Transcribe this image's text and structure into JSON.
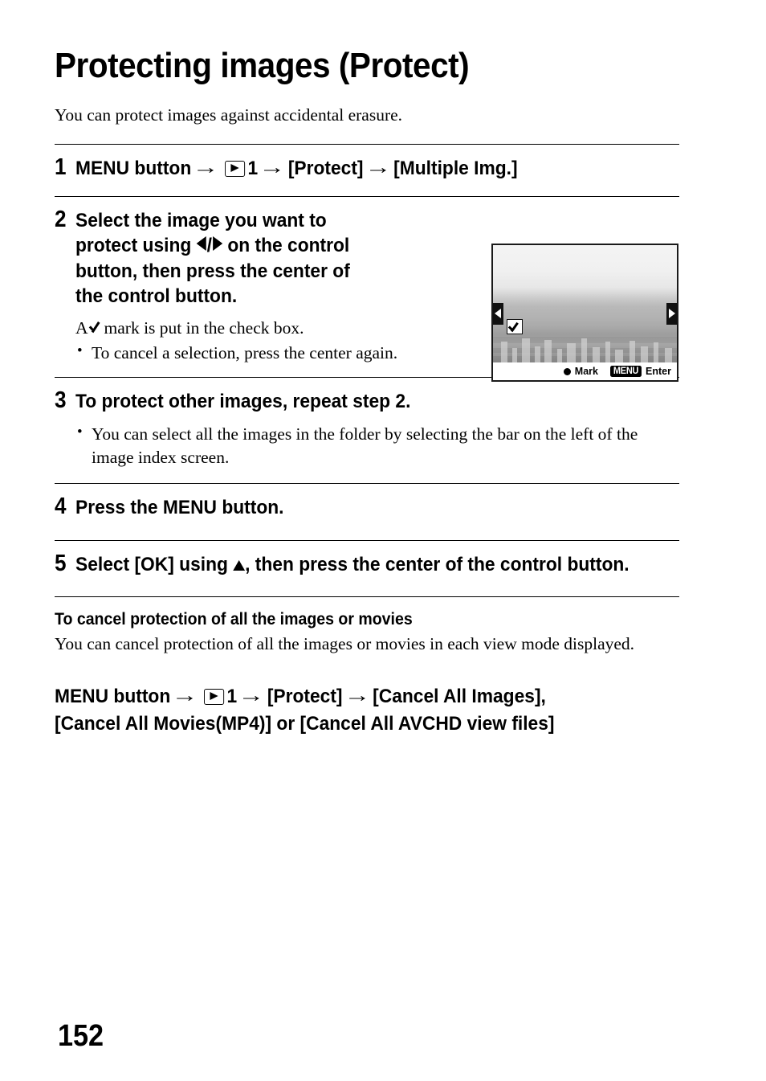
{
  "document": {
    "title": "Protecting images (Protect)",
    "intro": "You can protect images against accidental erasure.",
    "page_number": "152"
  },
  "steps": [
    {
      "number": "1",
      "heading_parts": {
        "a": "MENU button",
        "arrow": "→",
        "icon": "playback-icon",
        "b": "1",
        "c": "[Protect]",
        "d": "[Multiple Img.]"
      }
    },
    {
      "number": "2",
      "heading_l1": "Select the image you want to",
      "heading_l2_pre": "protect using",
      "heading_l2_post": "on the control",
      "heading_l3": "button, then press the center of",
      "heading_l4": "the control button.",
      "note_pre": "A",
      "note_post": "mark is put in the check box.",
      "bullets": [
        "To cancel a selection, press the center again."
      ]
    },
    {
      "number": "3",
      "heading": "To protect other images, repeat step 2.",
      "bullets": [
        "You can select all the images in the folder by selecting the bar on the left of the image index screen."
      ]
    },
    {
      "number": "4",
      "heading": "Press the MENU button."
    },
    {
      "number": "5",
      "heading_pre": "Select [OK] using",
      "heading_post": ", then press the center of the control button."
    }
  ],
  "camera_screen": {
    "mark_label": "Mark",
    "menu_chip_label": "MENU",
    "enter_label": "Enter",
    "checkbox_checked": "true",
    "left_arrow": "◀",
    "right_arrow": "▶"
  },
  "cancel_section": {
    "heading": "To cancel protection of all the images or movies",
    "body": "You can cancel protection of all the images or movies in each view mode displayed.",
    "menu_path": {
      "a": "MENU button",
      "arrow": "→",
      "icon": "playback-icon",
      "b": "1",
      "c": "[Protect]",
      "d": "[Cancel All Images],",
      "line2": "[Cancel All Movies(MP4)] or [Cancel All AVCHD view files]"
    }
  }
}
